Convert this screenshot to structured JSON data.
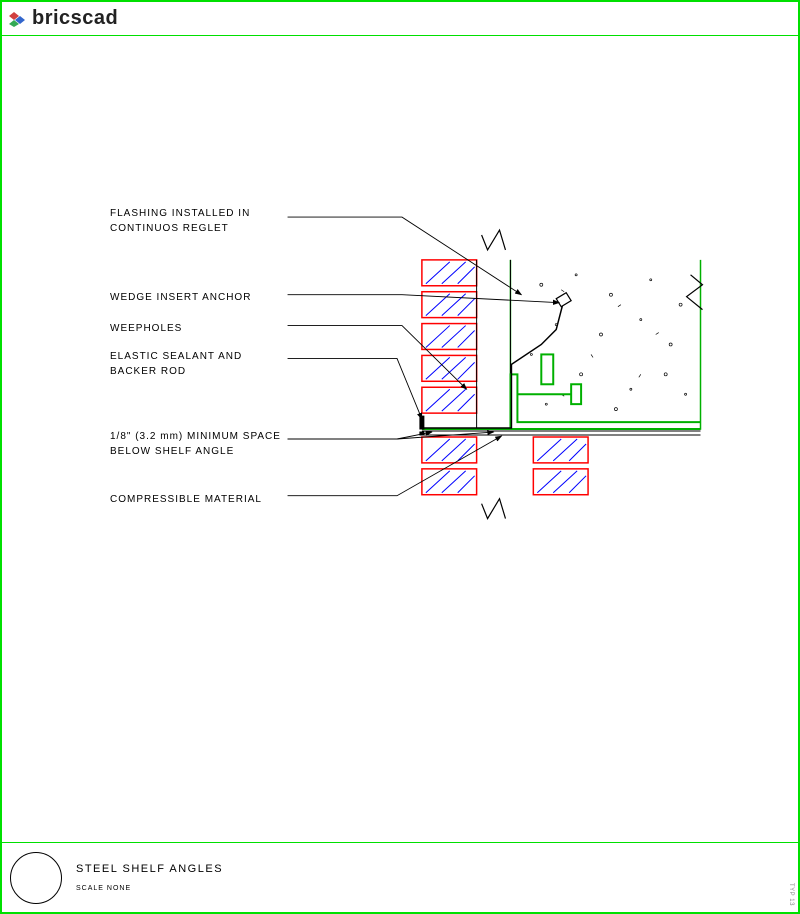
{
  "app": {
    "brand": "bricscad"
  },
  "labels": {
    "flashing_l1": "FLASHING INSTALLED IN",
    "flashing_l2": "CONTINUOS REGLET",
    "wedge": "WEDGE INSERT ANCHOR",
    "weepholes": "WEEPHOLES",
    "sealant_l1": "ELASTIC SEALANT AND",
    "sealant_l2": "BACKER ROD",
    "minspace_l1": "1/8\" (3.2 mm) MINIMUM SPACE",
    "minspace_l2": "BELOW SHELF ANGLE",
    "compressible": "COMPRESSIBLE MATERIAL"
  },
  "title_block": {
    "title": "STEEL SHELF ANGLES",
    "scale": "SCALE NONE"
  },
  "credit": "TYP 13"
}
